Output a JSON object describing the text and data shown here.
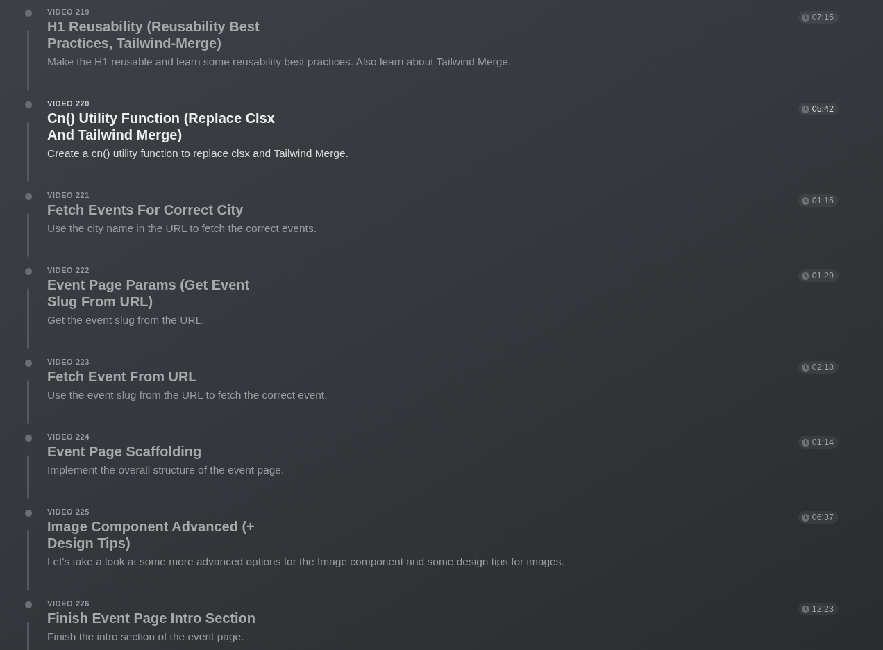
{
  "videos": [
    {
      "label": "VIDEO 219",
      "title": "H1 Reusability (Reusability Best Practices, Tailwind-Merge)",
      "description": "Make the H1 reusable and learn some reusability best practices. Also learn about Tailwind Merge.",
      "duration": "07:15",
      "selected": false
    },
    {
      "label": "VIDEO 220",
      "title": "Cn() Utility Function (Replace Clsx And Tailwind Merge)",
      "description": "Create a cn() utility function to replace clsx and Tailwind Merge.",
      "duration": "05:42",
      "selected": true
    },
    {
      "label": "VIDEO 221",
      "title": "Fetch Events For Correct City",
      "description": "Use the city name in the URL to fetch the correct events.",
      "duration": "01:15",
      "selected": false
    },
    {
      "label": "VIDEO 222",
      "title": "Event Page Params (Get Event Slug From URL)",
      "description": "Get the event slug from the URL.",
      "duration": "01:29",
      "selected": false
    },
    {
      "label": "VIDEO 223",
      "title": "Fetch Event From URL",
      "description": "Use the event slug from the URL to fetch the correct event.",
      "duration": "02:18",
      "selected": false
    },
    {
      "label": "VIDEO 224",
      "title": "Event Page Scaffolding",
      "description": "Implement the overall structure of the event page.",
      "duration": "01:14",
      "selected": false
    },
    {
      "label": "VIDEO 225",
      "title": "Image Component Advanced (+ Design Tips)",
      "description": "Let's take a look at some more advanced options for the Image component and some design tips for images.",
      "duration": "06:37",
      "selected": false
    },
    {
      "label": "VIDEO 226",
      "title": "Finish Event Page Intro Section",
      "description": "Finish the intro section of the event page.",
      "duration": "12:23",
      "selected": false
    }
  ]
}
